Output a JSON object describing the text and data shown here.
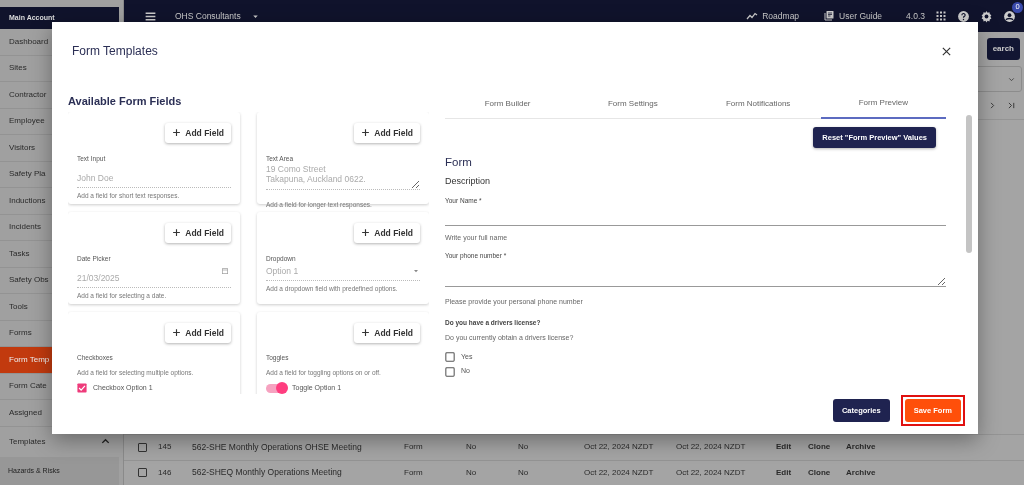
{
  "sidebar": {
    "header": "Main Account",
    "items": [
      {
        "label": "Dashboard",
        "selected": false
      },
      {
        "label": "Sites",
        "selected": false
      },
      {
        "label": "Contractor",
        "selected": false
      },
      {
        "label": "Employee",
        "selected": false
      },
      {
        "label": "Visitors",
        "selected": false
      },
      {
        "label": "Safety Pla",
        "selected": false
      },
      {
        "label": "Inductions",
        "selected": false
      },
      {
        "label": "Incidents",
        "selected": false
      },
      {
        "label": "Tasks",
        "selected": false
      },
      {
        "label": "Safety Obs",
        "selected": false
      },
      {
        "label": "Tools",
        "selected": false
      },
      {
        "label": "Forms",
        "selected": false
      },
      {
        "label": "Form Temp",
        "selected": true
      },
      {
        "label": "Form Cate",
        "selected": false
      },
      {
        "label": "Assigned",
        "selected": false
      }
    ],
    "group": {
      "label": "Templates",
      "expanded": true
    },
    "section": "Hazards & Risks"
  },
  "navbar": {
    "account": "OHS Consultants",
    "links": [
      "Roadmap",
      "User Guide"
    ],
    "version": "4.0.3",
    "notification_count": "0"
  },
  "background": {
    "search_button": "earch",
    "table_rows": [
      {
        "checked": false,
        "cells": [
          "145",
          "562-SHE Monthly Operations OHSE Meeting",
          "Form",
          "No",
          "No",
          "Oct 22, 2024 NZDT",
          "Oct 22, 2024 NZDT"
        ],
        "actions": [
          "Edit",
          "Clone",
          "Archive"
        ]
      },
      {
        "checked": false,
        "cells": [
          "146",
          "562-SHEQ Monthly Operations Meeting",
          "Form",
          "No",
          "No",
          "Oct 22, 2024 NZDT",
          "Oct 22, 2024 NZDT"
        ],
        "actions": [
          "Edit",
          "Clone",
          "Archive"
        ]
      }
    ]
  },
  "modal": {
    "title": "Form Templates",
    "fields_heading": "Available Form Fields",
    "field_cards": [
      {
        "kind": "text",
        "button": "Add Field",
        "label": "Text Input",
        "placeholder": "John Doe",
        "help": "Add a field for short text responses."
      },
      {
        "kind": "textarea",
        "button": "Add Field",
        "label": "Text Area",
        "placeholder": "19 Como Street\nTakapuna, Auckland 0622.",
        "help": "Add a field for longer text responses."
      },
      {
        "kind": "date",
        "button": "Add Field",
        "label": "Date Picker",
        "placeholder": "21/03/2025",
        "help": "Add a field for selecting a date."
      },
      {
        "kind": "dropdown",
        "button": "Add Field",
        "label": "Dropdown",
        "value": "Option 1",
        "help": "Add a dropdown field with predefined options."
      },
      {
        "kind": "checkboxes",
        "button": "Add Field",
        "label": "Checkboxes",
        "help": "Add a field for selecting multiple options.",
        "options": [
          {
            "label": "Checkbox Option 1",
            "checked": true
          }
        ]
      },
      {
        "kind": "toggles",
        "button": "Add Field",
        "label": "Toggles",
        "help": "Add a field for toggling options on or off.",
        "options": [
          {
            "label": "Toggle Option 1",
            "on": true
          }
        ]
      }
    ],
    "tabs": [
      {
        "label": "Form Builder",
        "selected": false
      },
      {
        "label": "Form Settings",
        "selected": false
      },
      {
        "label": "Form Notifications",
        "selected": false
      },
      {
        "label": "Form Preview",
        "selected": true
      }
    ],
    "reset_button": "Reset \"Form Preview\" Values",
    "preview": {
      "title": "Form",
      "description": "Description",
      "questions": [
        {
          "kind": "input",
          "label": "Your Name *",
          "hint": "Write your full name"
        },
        {
          "kind": "textarea",
          "label": "Your phone number *",
          "hint": "Please provide your personal phone number"
        },
        {
          "kind": "checkboxes",
          "label": "Do you have a drivers license?",
          "hint": "Do you currently obtain a drivers license?",
          "options": [
            {
              "label": "Yes",
              "checked": false
            },
            {
              "label": "No",
              "checked": false
            }
          ]
        }
      ]
    },
    "footer_buttons": [
      {
        "kind": "secondary",
        "label": "Categories",
        "highlighted": false
      },
      {
        "kind": "save",
        "label": "Save Form",
        "highlighted": true
      }
    ]
  }
}
